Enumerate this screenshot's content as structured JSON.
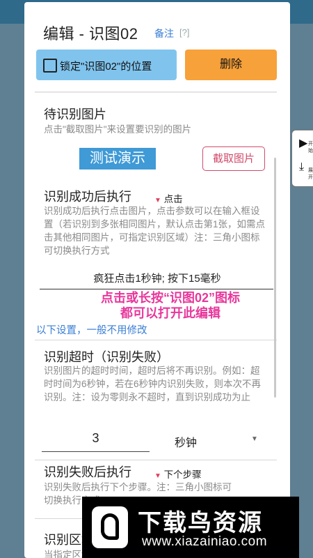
{
  "dialog": {
    "title": "编辑 - 识图02",
    "note_label": "备注",
    "note_help": "[?]"
  },
  "toolbar": {
    "lock_label": "锁定\"识图02\"的位置",
    "delete_label": "删除"
  },
  "image_section": {
    "heading": "待识别图片",
    "description": "点击\"截取图片\"来设置要识别的图片",
    "demo_label": "测试演示",
    "capture_label": "截取图片"
  },
  "success_section": {
    "heading": "识别成功后执行",
    "action": "点击",
    "description": "识别成功后执行点击图片，点击参数可以在输入框设置（若识别到多张相同图片，默认点击第1张，如需点击其他相同图片，可指定识别区域）注：三角小图标可切换执行方式",
    "input_value": "疯狂点击1秒钟; 按下15毫秒"
  },
  "overlay_hint": {
    "line1": "点击或长按“识图02”图标",
    "line2": "都可以打开此编辑"
  },
  "section_link": "以下设置，一般不用修改",
  "timeout_section": {
    "heading": "识别超时（识别失败）",
    "description": "识别图片的超时时间，超时后将不再识别。例如：超时时间为6秒钟，若在6秒钟内识别失败，则本次不再识别。注：设为零则永不超时，直到识别成功为止",
    "value": "3",
    "unit": "秒钟"
  },
  "fail_section": {
    "heading": "识别失败后执行",
    "action": "下个步骤",
    "description": "识别失败后执行下个步骤。注：三角小图标可切换执行方式"
  },
  "region_section": {
    "heading": "识别区域",
    "description": "当指定区域后，区域以外的就不再识别，指"
  },
  "side_tab": {
    "top_text": "开始",
    "bottom_text": "展开"
  },
  "watermark": {
    "title": "下载鸟资源",
    "url": "www.xiazainiao.com"
  },
  "colors": {
    "lock_button": "#80c4ee",
    "delete_button": "#f7a13a",
    "demo_button": "#3f9ad6",
    "capture_border": "#d04b6b",
    "link_blue": "#3a7fd5",
    "overlay_pink": "#e8379b",
    "dropdown_triangle": "#e53a5a"
  },
  "icons": {
    "dropdown": "triangle-down-icon",
    "checkbox": "checkbox-unchecked-icon",
    "play": "play-icon",
    "expand": "expand-icon"
  }
}
